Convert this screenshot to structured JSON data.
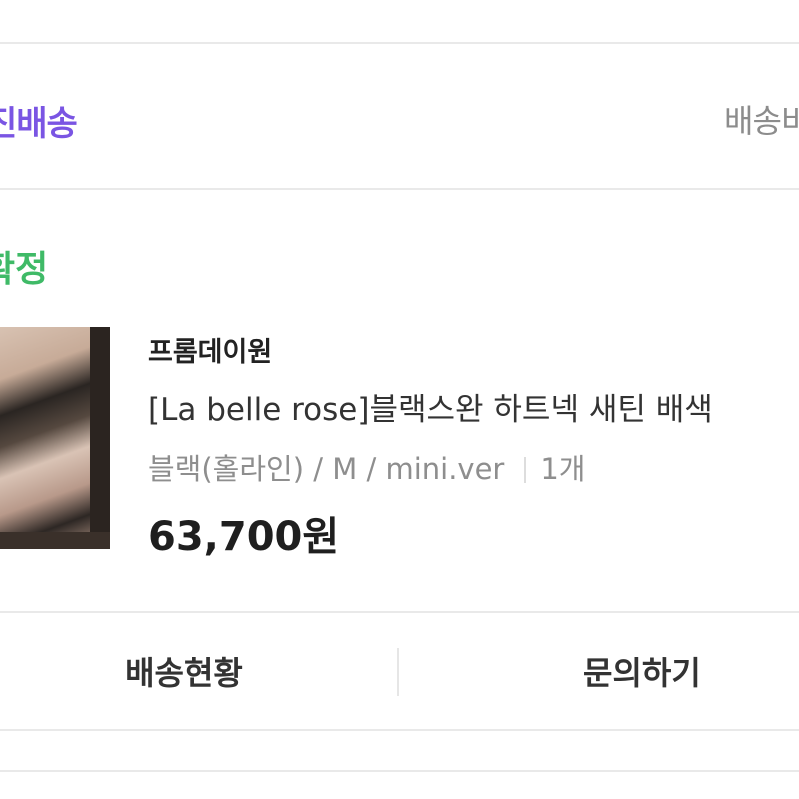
{
  "shipping": {
    "type_label": "진배송",
    "link_label": "배송비"
  },
  "order": {
    "status": "확정",
    "store": "프롬데이원",
    "product_name": "[La belle rose]블랙스완 하트넥 새틴 배색",
    "option": "블랙(홀라인) / M / mini.ver",
    "quantity": "1개",
    "price": "63,700원"
  },
  "actions": {
    "tracking_label": "배송현황",
    "inquiry_label": "문의하기"
  },
  "colors": {
    "accent_purple": "#7a55e3",
    "status_green": "#3fba67"
  }
}
